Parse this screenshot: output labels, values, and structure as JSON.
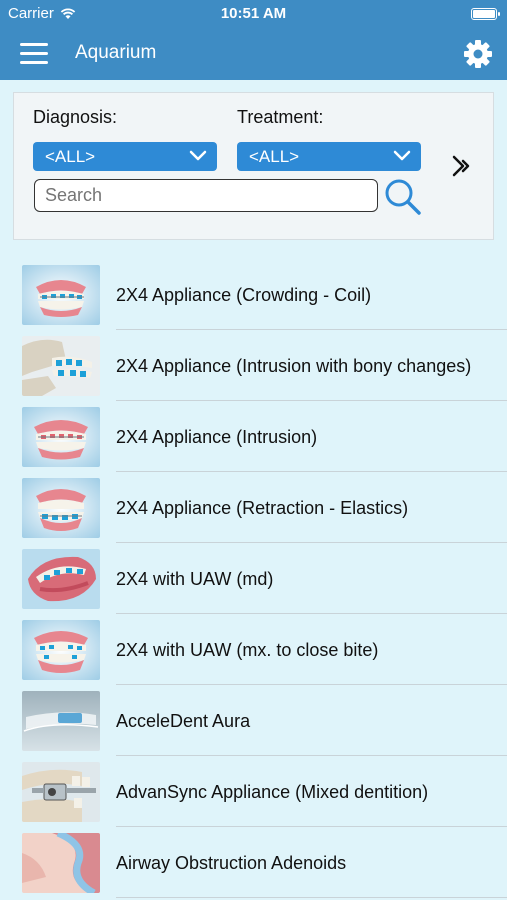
{
  "status_bar": {
    "carrier": "Carrier",
    "time": "10:51 AM"
  },
  "nav": {
    "title": "Aquarium",
    "menu_icon": "hamburger-menu-icon",
    "settings_icon": "gear-icon"
  },
  "filters": {
    "diagnosis_label": "Diagnosis:",
    "diagnosis_value": "<ALL>",
    "treatment_label": "Treatment:",
    "treatment_value": "<ALL>",
    "search_placeholder": "Search"
  },
  "colors": {
    "nav_bg": "#3e8cc4",
    "dropdown_bg": "#2e8ad6",
    "page_bg": "#dff4fa"
  },
  "items": [
    {
      "label": "2X4 Appliance (Crowding - Coil)",
      "thumb": "teeth-braces"
    },
    {
      "label": "2X4 Appliance (Intrusion with bony changes)",
      "thumb": "skull-braces"
    },
    {
      "label": "2X4 Appliance (Intrusion)",
      "thumb": "teeth-braces"
    },
    {
      "label": "2X4 Appliance (Retraction - Elastics)",
      "thumb": "teeth-braces"
    },
    {
      "label": "2X4 with UAW (md)",
      "thumb": "open-mouth"
    },
    {
      "label": "2X4 with UAW (mx. to close bite)",
      "thumb": "teeth-braces"
    },
    {
      "label": "AcceleDent Aura",
      "thumb": "device"
    },
    {
      "label": "AdvanSync Appliance (Mixed dentition)",
      "thumb": "appliance-hardware"
    },
    {
      "label": "Airway Obstruction Adenoids",
      "thumb": "airway"
    }
  ]
}
